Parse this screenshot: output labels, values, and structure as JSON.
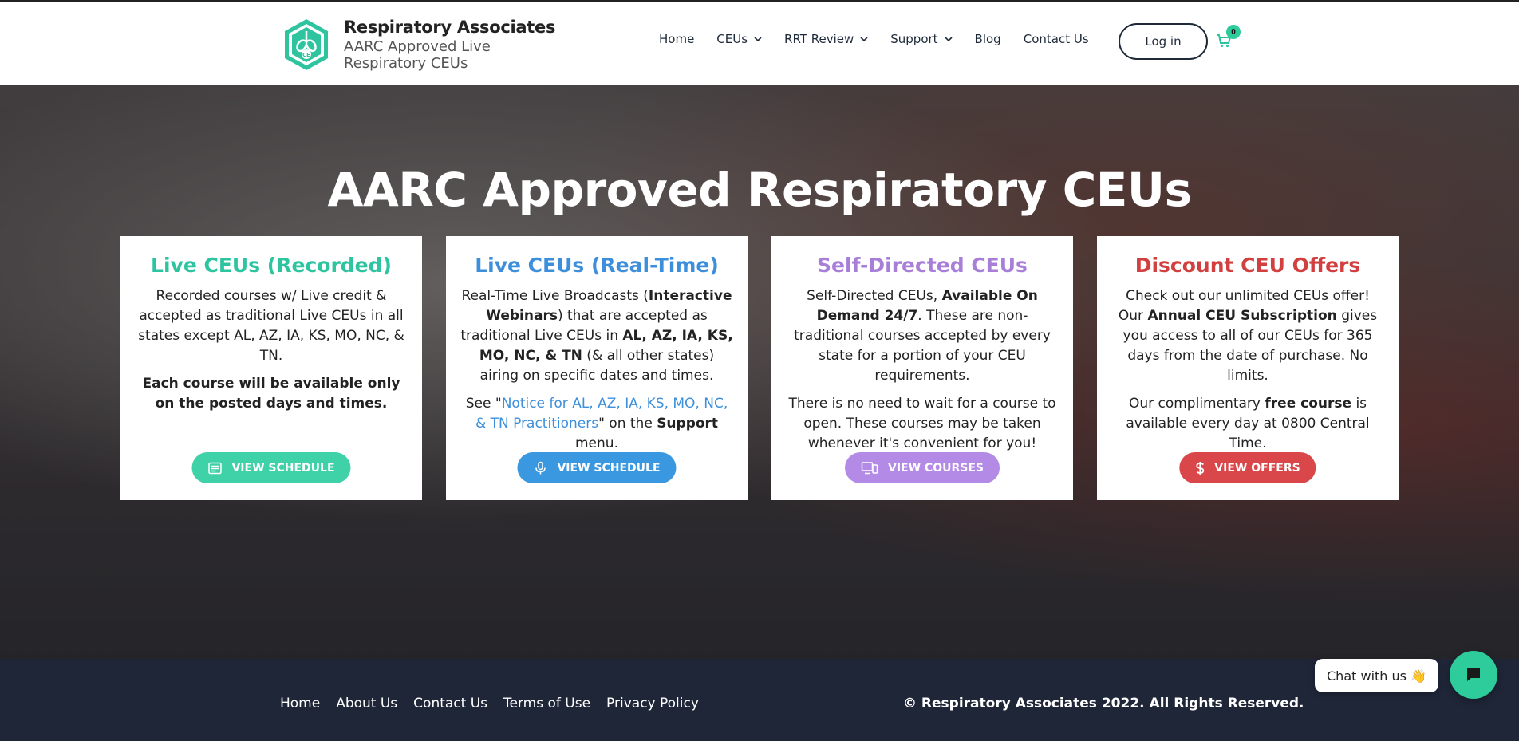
{
  "header": {
    "brand": "Respiratory Associates",
    "tagline": "AARC Approved Live Respiratory CEUs",
    "nav": [
      {
        "label": "Home",
        "dropdown": false
      },
      {
        "label": "CEUs",
        "dropdown": true
      },
      {
        "label": "RRT Review",
        "dropdown": true
      },
      {
        "label": "Support",
        "dropdown": true
      },
      {
        "label": "Blog",
        "dropdown": false
      },
      {
        "label": "Contact Us",
        "dropdown": false
      }
    ],
    "login_label": "Log in",
    "cart_count": "0"
  },
  "hero": {
    "title": "AARC Approved Respiratory CEUs"
  },
  "cards": [
    {
      "title": "Live CEUs (Recorded)",
      "title_color": "#2ec4a0",
      "p1": "Recorded courses w/ Live credit & accepted as traditional Live CEUs in all states except AL, AZ, IA, KS, MO, NC, & TN.",
      "p2": "Each course will be available only on the posted days and times.",
      "button_label": "VIEW SCHEDULE",
      "button_color": "#3fd1a7",
      "button_icon": "list-icon"
    },
    {
      "title": "Live CEUs (Real-Time)",
      "title_color": "#3d8fdc",
      "p1_a": "Real-Time Live Broadcasts (",
      "p1_b": "Interactive Webinars",
      "p1_c": ") that are accepted as traditional Live CEUs in ",
      "p1_d": "AL, AZ, IA, KS, MO, NC, & TN",
      "p1_e": " (& all other states) airing on specific dates and times.",
      "p2_a": "See \"",
      "p2_link": "Notice for AL, AZ, IA, KS, MO, NC, & TN Practitioners",
      "p2_b": "\" on the ",
      "p2_c": "Support",
      "p2_d": " menu.",
      "button_label": "VIEW SCHEDULE",
      "button_color": "#3a98e0",
      "button_icon": "microphone-icon"
    },
    {
      "title": "Self-Directed CEUs",
      "title_color": "#a77fd9",
      "p1_a": "Self-Directed CEUs, ",
      "p1_b": "Available On Demand 24/7",
      "p1_c": ". These are non-traditional courses accepted by every state for a portion of your CEU requirements.",
      "p2": "There is no need to wait for a course to open. These courses may be taken whenever it's convenient for you!",
      "button_label": "VIEW COURSES",
      "button_color": "#b38ae6",
      "button_icon": "devices-icon"
    },
    {
      "title": "Discount CEU Offers",
      "title_color": "#d13f3f",
      "p1_a": "Check out our unlimited CEUs offer! Our ",
      "p1_b": "Annual CEU Subscription",
      "p1_c": " gives you access to all of our CEUs for 365 days from the date of purchase. No limits.",
      "p2_a": "Our complimentary ",
      "p2_b": "free course",
      "p2_c": " is available every day at 0800 Central Time.",
      "button_label": "VIEW OFFERS",
      "button_color": "#d9474a",
      "button_icon": "dollar-icon"
    }
  ],
  "footer": {
    "links": [
      "Home",
      "About Us",
      "Contact Us",
      "Terms of Use",
      "Privacy Policy"
    ],
    "copyright": "© Respiratory Associates 2022. All Rights Reserved."
  },
  "chat": {
    "label": "Chat with us 👋"
  }
}
